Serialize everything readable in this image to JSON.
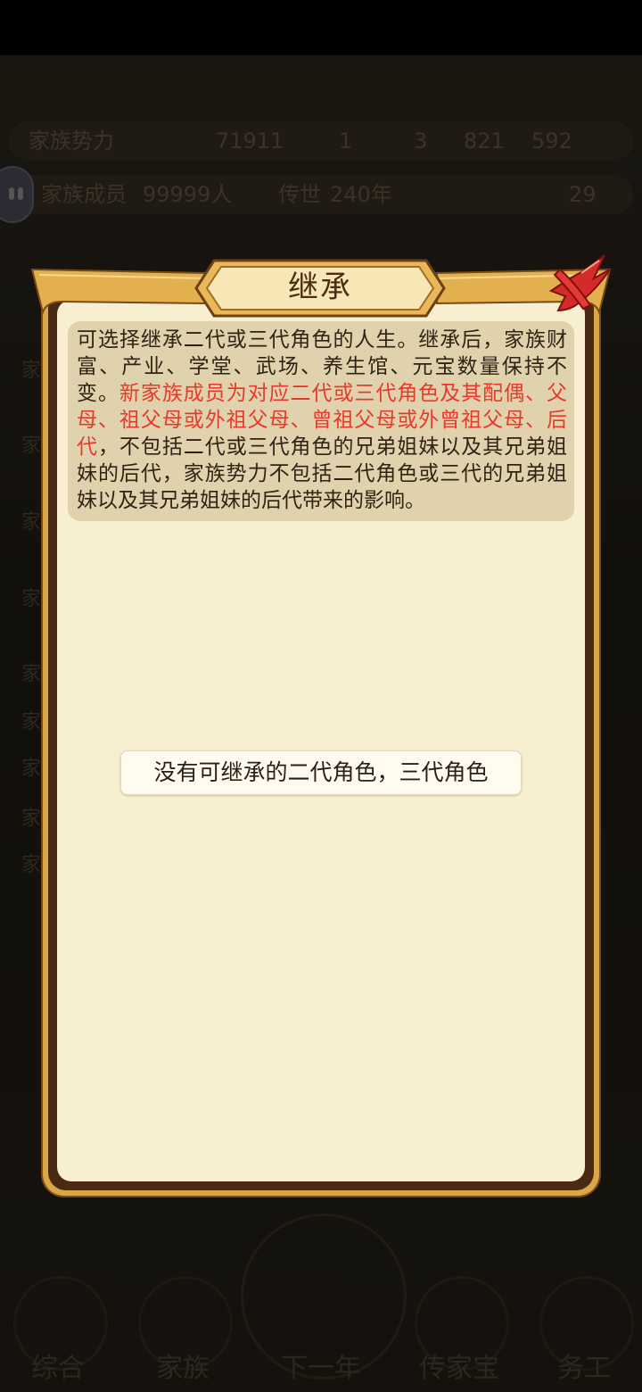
{
  "background": {
    "stats_row_1": {
      "label": "家族势力",
      "power_value": "71911",
      "small_value": "1",
      "count_a": "3",
      "count_b": "821",
      "count_c": "592"
    },
    "stats_row_2": {
      "members_label": "家族成员",
      "members_value": "99999人",
      "heritage_label": "传世",
      "heritage_value": "240年",
      "gold_value": "29"
    },
    "list_rows": [
      "家",
      "家",
      "家",
      "家",
      "家",
      "家",
      "家",
      "家",
      "家"
    ],
    "nav": [
      "综合",
      "家族",
      "下一年",
      "传家宝",
      "务工"
    ]
  },
  "dialog": {
    "title": "继承",
    "info_black_1": "可选择继承二代或三代角色的人生。继承后，家族财富、产业、学堂、武场、养生馆、元宝数量保持不变。",
    "info_red": "新家族成员为对应二代或三代角色及其配偶、父母、祖父母或外祖父母、曾祖父母或外曾祖父母、后代",
    "info_black_2": "，不包括二代或三代角色的兄弟姐妹以及其兄弟姐妹的后代，家族势力不包括二代角色或三代的兄弟姐妹以及其兄弟姐妹的后代带来的影响。",
    "empty_message": "没有可继承的二代角色，三代角色",
    "close_icon": "close-x-icon"
  },
  "colors": {
    "frame_gold": "#d9a744",
    "frame_brown": "#4a2a12",
    "body_cream": "#f7efcf",
    "info_bg": "#e0d2ad",
    "highlight_red": "#e8392d",
    "close_red": "#d42a2a"
  }
}
